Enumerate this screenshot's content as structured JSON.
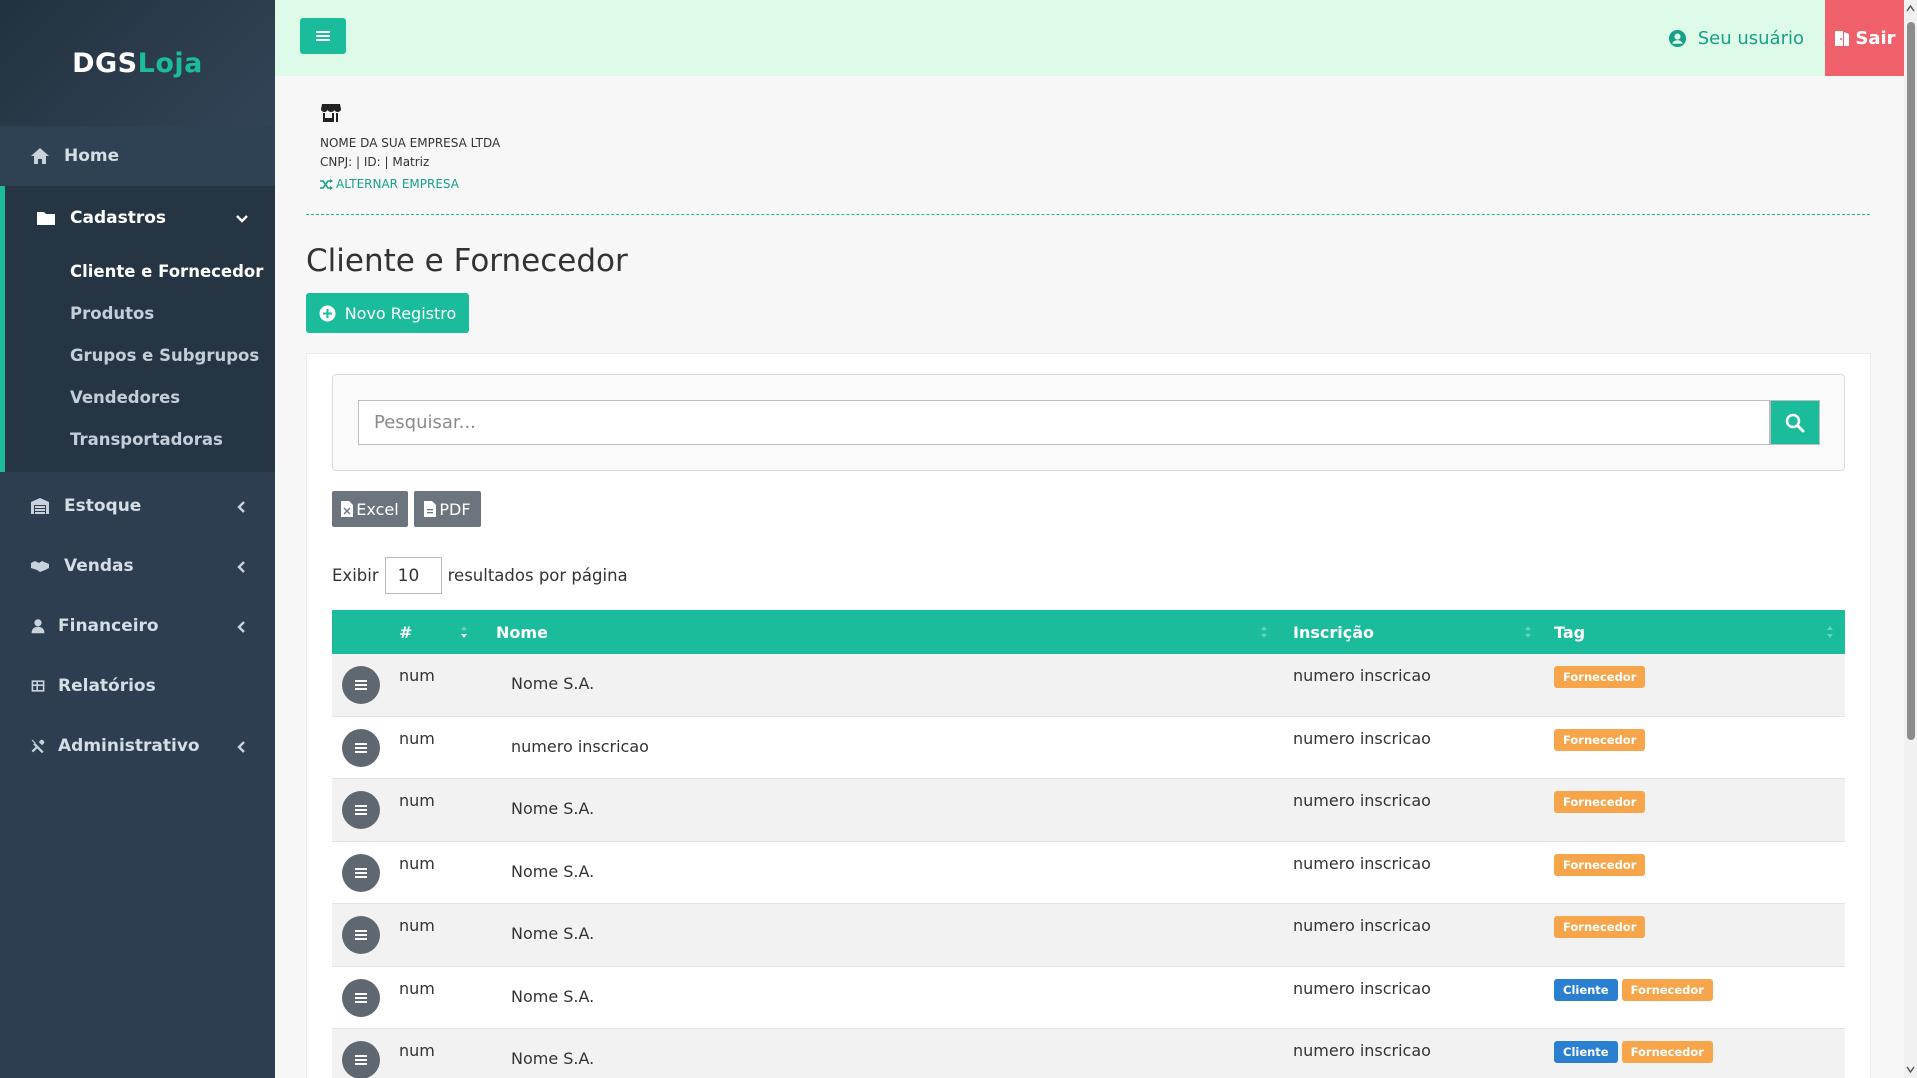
{
  "brand": {
    "part1": "DGS",
    "part2": "Loja"
  },
  "sidebar": {
    "items": [
      {
        "label": "Home",
        "icon": "home-icon"
      },
      {
        "label": "Cadastros",
        "icon": "folder-icon",
        "expanded": true,
        "sub": [
          "Cliente e Fornecedor",
          "Produtos",
          "Grupos e Subgrupos",
          "Vendedores",
          "Transportadoras"
        ],
        "active_sub": "Cliente e Fornecedor"
      },
      {
        "label": "Estoque",
        "icon": "warehouse-icon"
      },
      {
        "label": "Vendas",
        "icon": "handshake-icon"
      },
      {
        "label": "Financeiro",
        "icon": "user-dollar-icon"
      },
      {
        "label": "Relatórios",
        "icon": "table-icon"
      },
      {
        "label": "Administrativo",
        "icon": "tools-icon"
      }
    ]
  },
  "topbar": {
    "user_label": "Seu usuário",
    "logout_label": "Sair"
  },
  "company": {
    "name": "NOME DA SUA EMPRESA LTDA",
    "details": "CNPJ: | ID: | Matriz",
    "switch_label": "ALTERNAR EMPRESA"
  },
  "page": {
    "title": "Cliente e Fornecedor",
    "new_button": "Novo Registro"
  },
  "search": {
    "placeholder": "Pesquisar..."
  },
  "export": {
    "excel": "Excel",
    "pdf": "PDF"
  },
  "length": {
    "prefix": "Exibir",
    "value": "10",
    "suffix": "resultados por página"
  },
  "table": {
    "columns": [
      "#",
      "Nome",
      "Inscrição",
      "Tag"
    ],
    "rows": [
      {
        "num": "num",
        "nome": "Nome S.A.",
        "insc": "numero inscricao",
        "tags": [
          "Fornecedor"
        ]
      },
      {
        "num": "num",
        "nome": "numero inscricao",
        "insc": "numero inscricao",
        "tags": [
          "Fornecedor"
        ]
      },
      {
        "num": "num",
        "nome": "Nome S.A.",
        "insc": "numero inscricao",
        "tags": [
          "Fornecedor"
        ]
      },
      {
        "num": "num",
        "nome": "Nome S.A.",
        "insc": "numero inscricao",
        "tags": [
          "Fornecedor"
        ]
      },
      {
        "num": "num",
        "nome": "Nome S.A.",
        "insc": "numero inscricao",
        "tags": [
          "Fornecedor"
        ]
      },
      {
        "num": "num",
        "nome": "Nome S.A.",
        "insc": "numero inscricao",
        "tags": [
          "Cliente",
          "Fornecedor"
        ]
      },
      {
        "num": "num",
        "nome": "Nome S.A.",
        "insc": "numero inscricao",
        "tags": [
          "Cliente",
          "Fornecedor"
        ]
      }
    ]
  },
  "colors": {
    "accent": "#1abc9c",
    "sidebar": "#2c3e50",
    "logout": "#f0606b",
    "tag_fornecedor": "#f7a54a",
    "tag_cliente": "#2b7fd1"
  }
}
